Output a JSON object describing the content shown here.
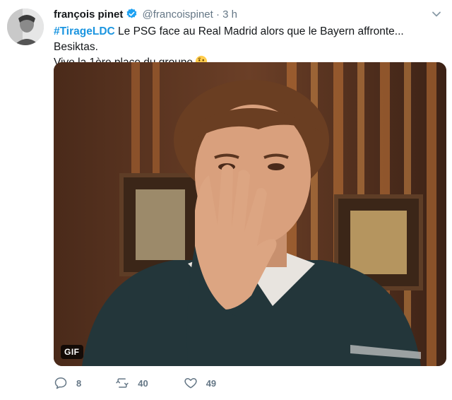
{
  "author": {
    "name": "françois pinet",
    "handle": "@francoispinet",
    "time": "3 h",
    "separator": "·"
  },
  "tweet": {
    "hashtag": "#TirageLDC",
    "text_line1": " Le PSG face au Real Madrid alors que le Bayern affronte... Besiktas.",
    "text_line2": "Vive la 1ère place du groupe"
  },
  "media": {
    "badge": "GIF"
  },
  "actions": {
    "reply_count": "8",
    "retweet_count": "40",
    "like_count": "49"
  },
  "colors": {
    "link": "#1b95e0",
    "muted": "#657786",
    "text": "#14171a"
  },
  "icons": [
    "verified-badge-icon",
    "chevron-down-icon",
    "thinking-face-emoji",
    "reply-icon",
    "retweet-icon",
    "like-heart-icon"
  ]
}
